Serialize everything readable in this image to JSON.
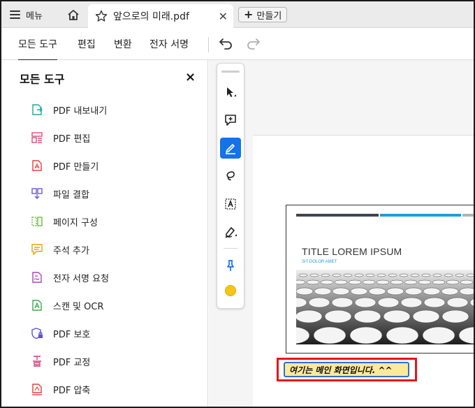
{
  "tabbar": {
    "menu_label": "메뉴",
    "tab_title": "앞으로의 미래.pdf",
    "new_button_label": "만들기"
  },
  "toolbar": {
    "tabs": [
      {
        "label": "모든 도구",
        "active": true
      },
      {
        "label": "편집"
      },
      {
        "label": "변환"
      },
      {
        "label": "전자 서명"
      }
    ]
  },
  "panel": {
    "title": "모든 도구",
    "tools": [
      {
        "label": "PDF 내보내기",
        "icon": "export-pdf-icon",
        "color": "#26a69a"
      },
      {
        "label": "PDF 편집",
        "icon": "edit-pdf-icon",
        "color": "#e04a7a"
      },
      {
        "label": "PDF 만들기",
        "icon": "create-pdf-icon",
        "color": "#e0403a"
      },
      {
        "label": "파일 결합",
        "icon": "combine-files-icon",
        "color": "#6a5acd"
      },
      {
        "label": "페이지 구성",
        "icon": "organize-pages-icon",
        "color": "#6dbb3a"
      },
      {
        "label": "주석 추가",
        "icon": "comment-icon",
        "color": "#e6a800"
      },
      {
        "label": "전자 서명 요청",
        "icon": "request-signature-icon",
        "color": "#b040c0"
      },
      {
        "label": "스캔 및 OCR",
        "icon": "scan-ocr-icon",
        "color": "#3cab4a"
      },
      {
        "label": "PDF 보호",
        "icon": "protect-pdf-icon",
        "color": "#5a54d6"
      },
      {
        "label": "PDF 교정",
        "icon": "redact-pdf-icon",
        "color": "#d03a7a"
      },
      {
        "label": "PDF 압축",
        "icon": "compress-pdf-icon",
        "color": "#e0403a"
      }
    ]
  },
  "slide": {
    "title": "TITLE LOREM IPSUM",
    "subtitle": "SIT DOLOR AMET"
  },
  "annotation": {
    "note_text": "여기는 메인 화면입니다. ^^"
  },
  "colors": {
    "accent": "#1473e6",
    "highlight_border": "#e8141c",
    "note_fill": "#fde99a"
  }
}
